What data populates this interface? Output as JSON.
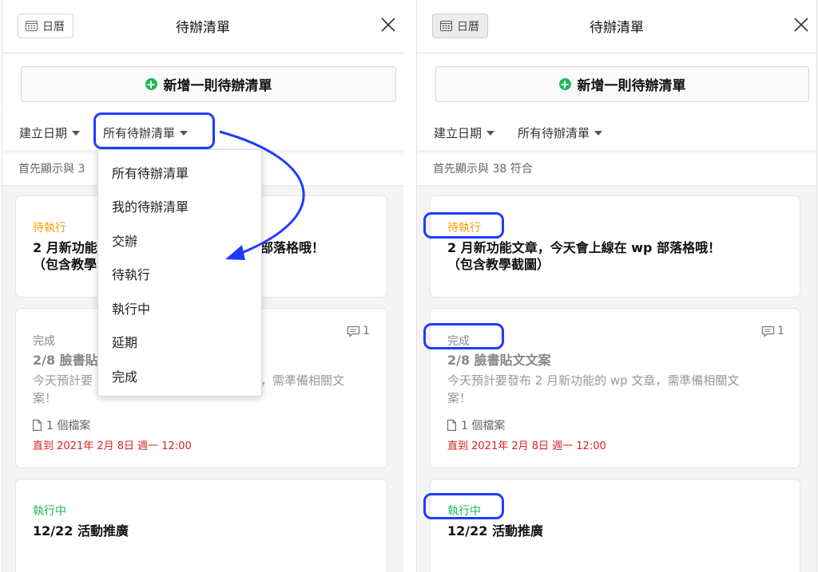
{
  "calendar_label": "日曆",
  "title": "待辦清單",
  "add_button": "新增一則待辦清單",
  "sort_label": "建立日期",
  "filter_label": "所有待辦清單",
  "result_text_left": "首先顯示與 3",
  "result_text": "首先顯示與 38 符合",
  "dropdown_options": [
    "所有待辦清單",
    "我的待辦清單",
    "交辦",
    "待執行",
    "執行中",
    "延期",
    "完成"
  ],
  "cards": [
    {
      "status": "待執行",
      "title_line1": "2 月新功能文章，今天會上線在 wp 部落格哦！",
      "title_line2": "（包含教學截圖）",
      "left_title_line1_a": "2 月新功能",
      "left_title_line1_b": "部落格哦！",
      "left_title_line2": "（包含教學"
    },
    {
      "status": "完成",
      "title": "2/8 臉書貼文文案",
      "desc_line1": "今天預計要發布 2 月新功能的 wp 文章，需準備相關文",
      "desc_line2": "案！",
      "left_title": "2/8 臉書貼",
      "left_desc_line1_a": "今天預計要",
      "left_desc_line1_b": "，需準備相關文",
      "files": "1 個檔案",
      "due": "直到 2021年 2月 8日 週一 12:00",
      "comments": "1"
    },
    {
      "status": "執行中",
      "title": "12/22 活動推廣"
    }
  ],
  "colors": {
    "pending": "#f2a100",
    "done": "#888888",
    "doing": "#1db954",
    "due": "#e02020",
    "annotation": "#1f3bff"
  }
}
